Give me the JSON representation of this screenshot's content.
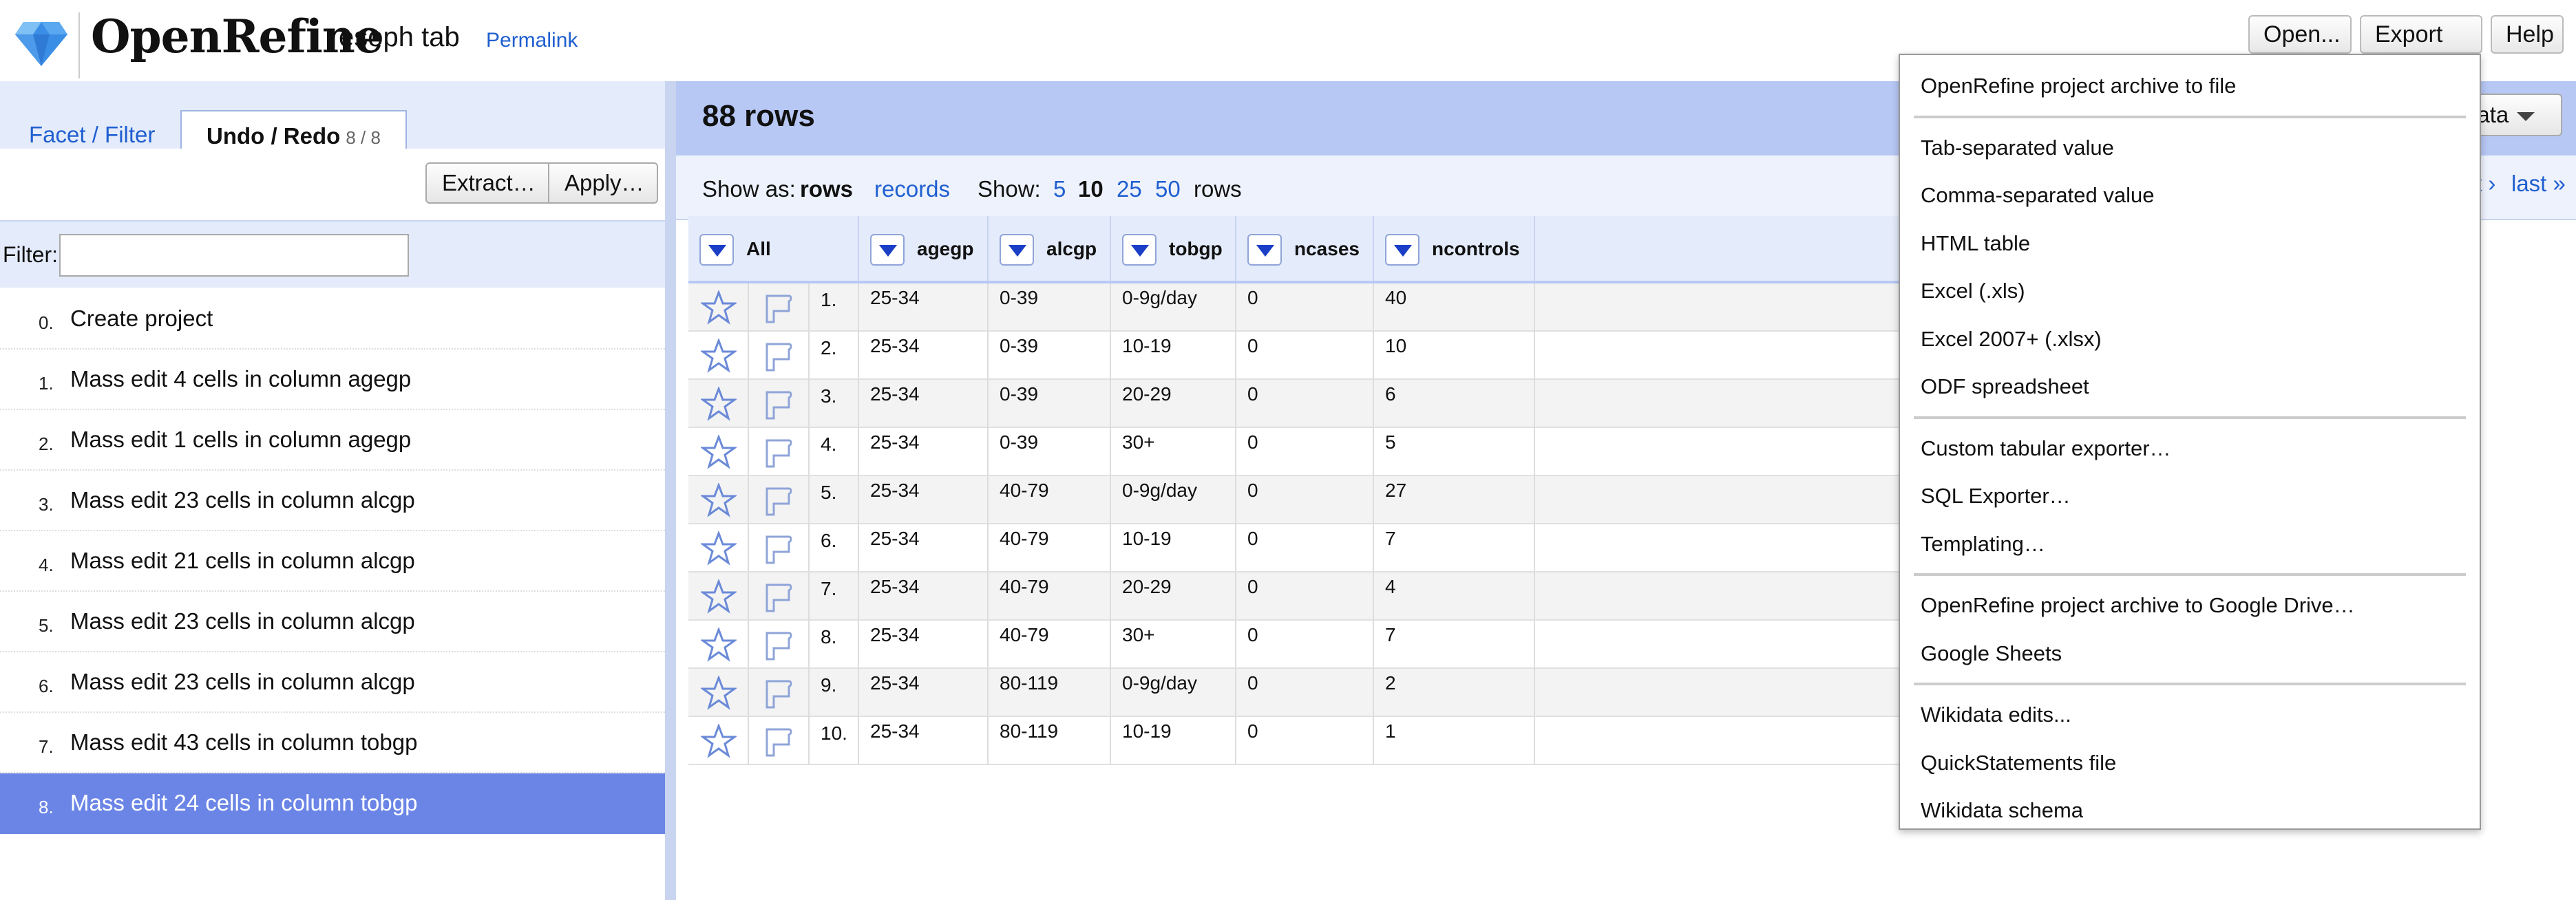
{
  "app": {
    "logo_text": "OpenRefine",
    "project_name": "esoph tab",
    "permalink": "Permalink"
  },
  "top_buttons": {
    "open": "Open...",
    "export": "Export",
    "help": "Help"
  },
  "left": {
    "tabs": {
      "facet": "Facet / Filter",
      "undo": "Undo / Redo",
      "undo_count": "8 / 8"
    },
    "extract_label": "Extract…",
    "apply_label": "Apply…",
    "filter_label": "Filter:",
    "filter_value": "",
    "history": [
      {
        "num": "0.",
        "text": "Create project"
      },
      {
        "num": "1.",
        "text": "Mass edit 4 cells in column agegp"
      },
      {
        "num": "2.",
        "text": "Mass edit 1 cells in column agegp"
      },
      {
        "num": "3.",
        "text": "Mass edit 23 cells in column alcgp"
      },
      {
        "num": "4.",
        "text": "Mass edit 21 cells in column alcgp"
      },
      {
        "num": "5.",
        "text": "Mass edit 23 cells in column alcgp"
      },
      {
        "num": "6.",
        "text": "Mass edit 23 cells in column alcgp"
      },
      {
        "num": "7.",
        "text": "Mass edit 43 cells in column tobgp"
      },
      {
        "num": "8.",
        "text": "Mass edit 24 cells in column tobgp"
      }
    ],
    "selected_history_index": 8
  },
  "data_view": {
    "rows_title": "88 rows",
    "wikidata_label": "data",
    "show_as_label": "Show as:",
    "rows_mode": "rows",
    "records_mode": "records",
    "show_label": "Show:",
    "page_sizes": [
      "5",
      "10",
      "25",
      "50"
    ],
    "page_size_selected": "10",
    "rows_suffix": "rows",
    "next_label": "t ›",
    "last_label": "last »",
    "columns": [
      "All",
      "agegp",
      "alcgp",
      "tobgp",
      "ncases",
      "ncontrols"
    ],
    "rows": [
      {
        "n": "1.",
        "agegp": "25-34",
        "alcgp": "0-39",
        "tobgp": "0-9g/day",
        "ncases": "0",
        "ncontrols": "40"
      },
      {
        "n": "2.",
        "agegp": "25-34",
        "alcgp": "0-39",
        "tobgp": "10-19",
        "ncases": "0",
        "ncontrols": "10"
      },
      {
        "n": "3.",
        "agegp": "25-34",
        "alcgp": "0-39",
        "tobgp": "20-29",
        "ncases": "0",
        "ncontrols": "6"
      },
      {
        "n": "4.",
        "agegp": "25-34",
        "alcgp": "0-39",
        "tobgp": "30+",
        "ncases": "0",
        "ncontrols": "5"
      },
      {
        "n": "5.",
        "agegp": "25-34",
        "alcgp": "40-79",
        "tobgp": "0-9g/day",
        "ncases": "0",
        "ncontrols": "27"
      },
      {
        "n": "6.",
        "agegp": "25-34",
        "alcgp": "40-79",
        "tobgp": "10-19",
        "ncases": "0",
        "ncontrols": "7"
      },
      {
        "n": "7.",
        "agegp": "25-34",
        "alcgp": "40-79",
        "tobgp": "20-29",
        "ncases": "0",
        "ncontrols": "4"
      },
      {
        "n": "8.",
        "agegp": "25-34",
        "alcgp": "40-79",
        "tobgp": "30+",
        "ncases": "0",
        "ncontrols": "7"
      },
      {
        "n": "9.",
        "agegp": "25-34",
        "alcgp": "80-119",
        "tobgp": "0-9g/day",
        "ncases": "0",
        "ncontrols": "2"
      },
      {
        "n": "10.",
        "agegp": "25-34",
        "alcgp": "80-119",
        "tobgp": "10-19",
        "ncases": "0",
        "ncontrols": "1"
      }
    ]
  },
  "export_menu": {
    "groups": [
      [
        "OpenRefine project archive to file"
      ],
      [
        "Tab-separated value",
        "Comma-separated value",
        "HTML table",
        "Excel (.xls)",
        "Excel 2007+ (.xlsx)",
        "ODF spreadsheet"
      ],
      [
        "Custom tabular exporter…",
        "SQL Exporter…",
        "Templating…"
      ],
      [
        "OpenRefine project archive to Google Drive…",
        "Google Sheets"
      ],
      [
        "Wikidata edits...",
        "QuickStatements file",
        "Wikidata schema"
      ]
    ]
  },
  "colors": {
    "accent_blue": "#1f5fd0",
    "selected_row": "#6b85e6",
    "header_bar": "#b7c8f4",
    "panel_bg": "#e4ebfb"
  }
}
